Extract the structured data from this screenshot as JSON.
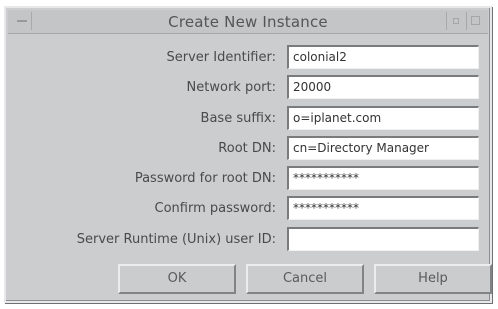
{
  "window": {
    "title": "Create New Instance"
  },
  "form": {
    "fields": [
      {
        "label": "Server Identifier:",
        "value": "colonial2"
      },
      {
        "label": "Network port:",
        "value": "20000"
      },
      {
        "label": "Base suffix:",
        "value": "o=iplanet.com"
      },
      {
        "label": "Root DN:",
        "value": "cn=Directory Manager"
      },
      {
        "label": "Password for root DN:",
        "value": "***********"
      },
      {
        "label": "Confirm password:",
        "value": "***********"
      },
      {
        "label": "Server Runtime (Unix) user ID:",
        "value": ""
      }
    ]
  },
  "buttons": {
    "ok": "OK",
    "cancel": "Cancel",
    "help": "Help"
  }
}
